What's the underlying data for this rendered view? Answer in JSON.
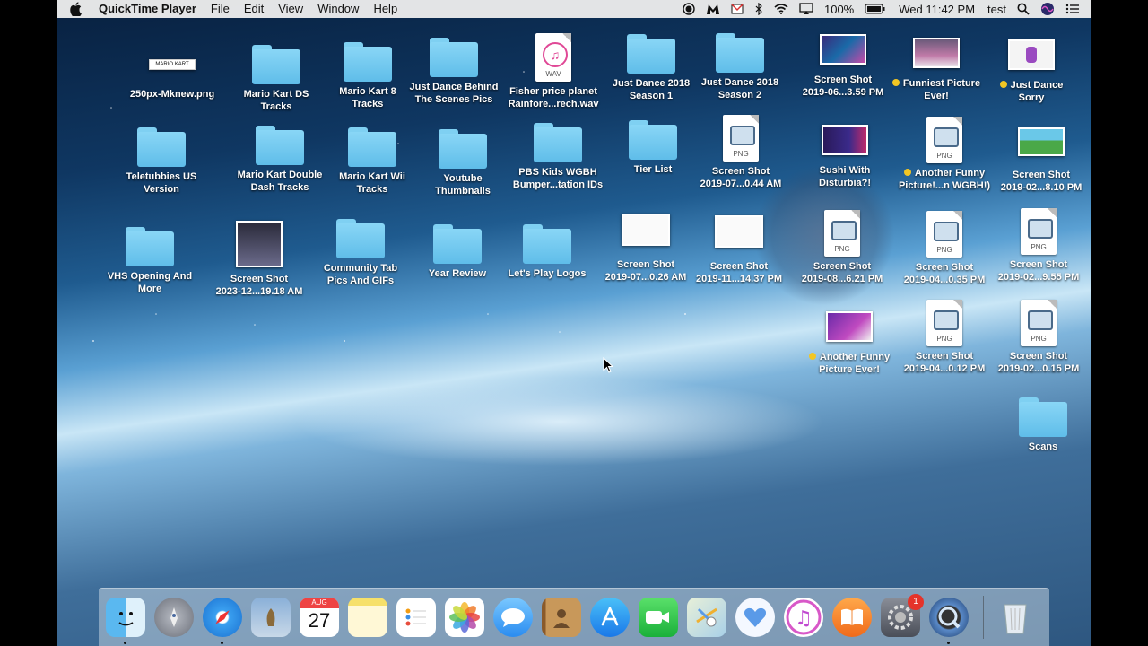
{
  "menubar": {
    "app_name": "QuickTime Player",
    "menus": [
      "File",
      "Edit",
      "View",
      "Window",
      "Help"
    ],
    "battery": "100%",
    "clock": "Wed 11:42 PM",
    "user": "test"
  },
  "desktop_items": [
    {
      "label": "250px-Mknew.png",
      "kind": "image"
    },
    {
      "label": "Mario Kart DS\nTracks",
      "kind": "folder"
    },
    {
      "label": "Mario Kart 8\nTracks",
      "kind": "folder"
    },
    {
      "label": "Just Dance Behind\nThe Scenes Pics",
      "kind": "folder"
    },
    {
      "label": "Fisher price planet\nRainfore...rech.wav",
      "kind": "wav"
    },
    {
      "label": "Just Dance 2018\nSeason 1",
      "kind": "folder"
    },
    {
      "label": "Just Dance 2018\nSeason 2",
      "kind": "folder"
    },
    {
      "label": "Screen Shot\n2019-06...3.59 PM",
      "kind": "image"
    },
    {
      "label": "Funniest Picture\nEver!",
      "kind": "image",
      "tag": true
    },
    {
      "label": "Just Dance\nSorry",
      "kind": "image",
      "tag": true
    },
    {
      "label": "Teletubbies US\nVersion",
      "kind": "folder"
    },
    {
      "label": "Mario Kart Double\nDash Tracks",
      "kind": "folder"
    },
    {
      "label": "Mario Kart Wii\nTracks",
      "kind": "folder"
    },
    {
      "label": "Youtube\nThumbnails",
      "kind": "folder"
    },
    {
      "label": "PBS Kids WGBH\nBumper...tation IDs",
      "kind": "folder"
    },
    {
      "label": "Tier List",
      "kind": "folder"
    },
    {
      "label": "Screen Shot\n2019-07...0.44 AM",
      "kind": "png"
    },
    {
      "label": "Sushi With\nDisturbia?!",
      "kind": "image"
    },
    {
      "label": "Another Funny\nPicture!...n WGBH!)",
      "kind": "png",
      "tag": true
    },
    {
      "label": "Screen Shot\n2019-02...8.10 PM",
      "kind": "image"
    },
    {
      "label": "VHS Opening And\nMore",
      "kind": "folder"
    },
    {
      "label": "Screen Shot\n2023-12...19.18 AM",
      "kind": "image"
    },
    {
      "label": "Community Tab\nPics And GIFs",
      "kind": "folder"
    },
    {
      "label": "Year Review",
      "kind": "folder"
    },
    {
      "label": "Let's Play Logos",
      "kind": "folder"
    },
    {
      "label": "Screen Shot\n2019-07...0.26 AM",
      "kind": "image"
    },
    {
      "label": "Screen Shot\n2019-11...14.37 PM",
      "kind": "image"
    },
    {
      "label": "Screen Shot\n2019-08...6.21 PM",
      "kind": "png"
    },
    {
      "label": "Screen Shot\n2019-04...0.35 PM",
      "kind": "png"
    },
    {
      "label": "Screen Shot\n2019-02...9.55 PM",
      "kind": "png"
    },
    {
      "label": "Another Funny\nPicture Ever!",
      "kind": "image",
      "tag": true
    },
    {
      "label": "Screen Shot\n2019-04...0.12 PM",
      "kind": "png"
    },
    {
      "label": "Screen Shot\n2019-02...0.15 PM",
      "kind": "png"
    },
    {
      "label": "Scans",
      "kind": "folder"
    }
  ],
  "file_ext": {
    "wav": "WAV",
    "png": "PNG"
  },
  "thumb_text": {
    "mario_kart_logo": "MARIO KART"
  },
  "dock": {
    "apps": [
      "finder",
      "launchpad",
      "safari",
      "mail",
      "calendar",
      "notes",
      "reminders",
      "photos",
      "messages",
      "contacts",
      "app-store",
      "facetime",
      "maps",
      "elsewhere",
      "itunes",
      "ibooks",
      "system-preferences",
      "quicktime",
      "trash"
    ],
    "calendar_month": "AUG",
    "calendar_day": "27",
    "system_prefs_badge": "1"
  },
  "colors": {
    "folder": "#6cc6ef",
    "menubar": "#ececec",
    "tag_yellow": "#f3c623"
  }
}
